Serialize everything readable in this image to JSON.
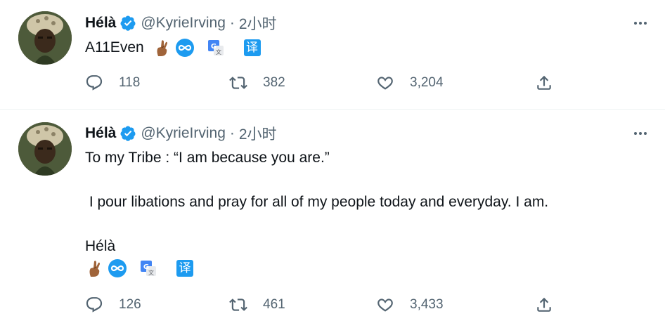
{
  "tweets": [
    {
      "name": "Hélà",
      "handle": "@KyrieIrving",
      "separator": "·",
      "time": "2小时",
      "text_lines": [
        "A11Even"
      ],
      "reply_count": "118",
      "retweet_count": "382",
      "like_count": "3,204"
    },
    {
      "name": "Hélà",
      "handle": "@KyrieIrving",
      "separator": "·",
      "time": "2小时",
      "text_lines": [
        "To my Tribe : “I am because you are.”",
        " I pour libations and pray for all of my people today and everyday. I am.",
        "Hélà"
      ],
      "reply_count": "126",
      "retweet_count": "461",
      "like_count": "3,433"
    }
  ],
  "icons": {
    "verified": "verified-badge-icon",
    "more": "more-dots-icon",
    "reply": "reply-icon",
    "retweet": "retweet-icon",
    "like": "heart-icon",
    "share": "share-icon",
    "emoji_fingers": "crossed-fingers-emoji",
    "emoji_infinity": "infinity-emoji",
    "translate_google": "google-translate-icon",
    "translate_cn": "translate-cn-icon"
  },
  "translate_glyph": "译",
  "colors": {
    "accent": "#1d9bf0",
    "text": "#0f1419",
    "secondary": "#536471",
    "divider": "#eff3f4"
  }
}
